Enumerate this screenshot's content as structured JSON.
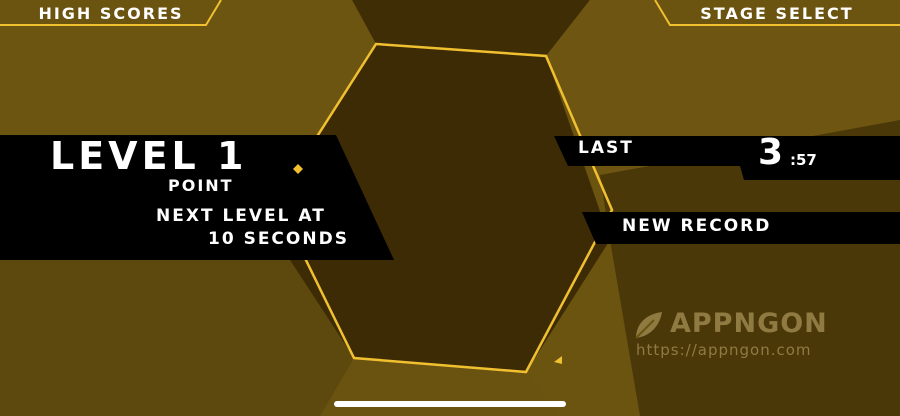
{
  "top_left_button": {
    "label": "HIGH SCORES"
  },
  "top_right_button": {
    "label": "STAGE SELECT"
  },
  "level_panel": {
    "title": "LEVEL 1",
    "subtitle": "POINT",
    "next_line_1": "NEXT LEVEL AT",
    "next_line_2": "10 SECONDS"
  },
  "last_panel": {
    "label": "LAST",
    "seconds": "3",
    "fraction": ":57"
  },
  "record_panel": {
    "label": "NEW RECORD"
  },
  "watermark": {
    "name": "APPNGON",
    "url": "https://appngon.com"
  },
  "colors": {
    "accent_yellow": "#f0c030",
    "background_dark": "#3e2c06",
    "background_mid": "#6b5310",
    "panel_black": "#000000"
  }
}
